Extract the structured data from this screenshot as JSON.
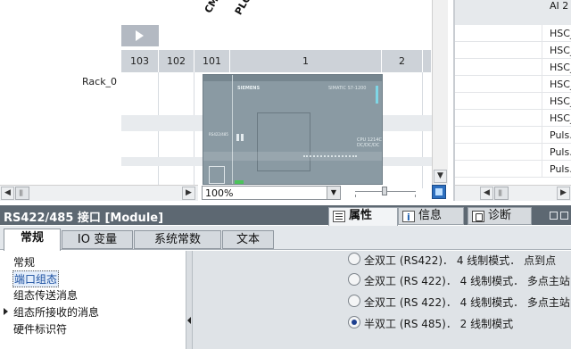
{
  "device_view": {
    "module_labels": [
      "CM",
      "PLC_"
    ],
    "rack_label": "Rack_0",
    "slot_headers": [
      "103",
      "102",
      "101",
      "1",
      "2"
    ],
    "plc": {
      "brand": "SIEMENS",
      "model": "SIMATIC S7-1200",
      "cpu_text": "CPU 1214C\nDC/DC/DC"
    },
    "zoom": {
      "value": "100%"
    }
  },
  "right_panel": {
    "top_item": "AI 2",
    "items": [
      "HSC_",
      "HSC_",
      "HSC_",
      "HSC_",
      "HSC_",
      "HSC_",
      "Puls.",
      "Puls.",
      "Puls."
    ]
  },
  "inspector": {
    "title": "RS422/485 接口 [Module]",
    "tabs": [
      {
        "label": "属性",
        "icon": "properties-icon"
      },
      {
        "label": "信息",
        "icon": "info-icon"
      },
      {
        "label": "诊断",
        "icon": "diagnostics-icon"
      }
    ],
    "subtabs": [
      "常规",
      "IO 变量",
      "系统常数",
      "文本"
    ],
    "nav": [
      "常规",
      "端口组态",
      "组态传送消息",
      "组态所接收的消息",
      "硬件标识符"
    ],
    "selected_nav": "端口组态",
    "options": [
      {
        "label": "全双工 (RS422)． 4 线制模式． 点到点",
        "selected": false
      },
      {
        "label": "全双工 (RS 422)． 4 线制模式． 多点主站",
        "selected": false
      },
      {
        "label": "全双工 (RS 422)． 4 线制模式． 多点主站",
        "selected": false
      },
      {
        "label": "半双工 (RS 485)． 2 线制模式",
        "selected": true
      }
    ]
  },
  "colors": {
    "inspector_title_bg": "#5d6872",
    "slot_header_bg": "#cdd2d8",
    "plc_body": "#8a9aa3",
    "content_bg": "#dfe3e7",
    "radio_selected": "#1d3f8f"
  }
}
